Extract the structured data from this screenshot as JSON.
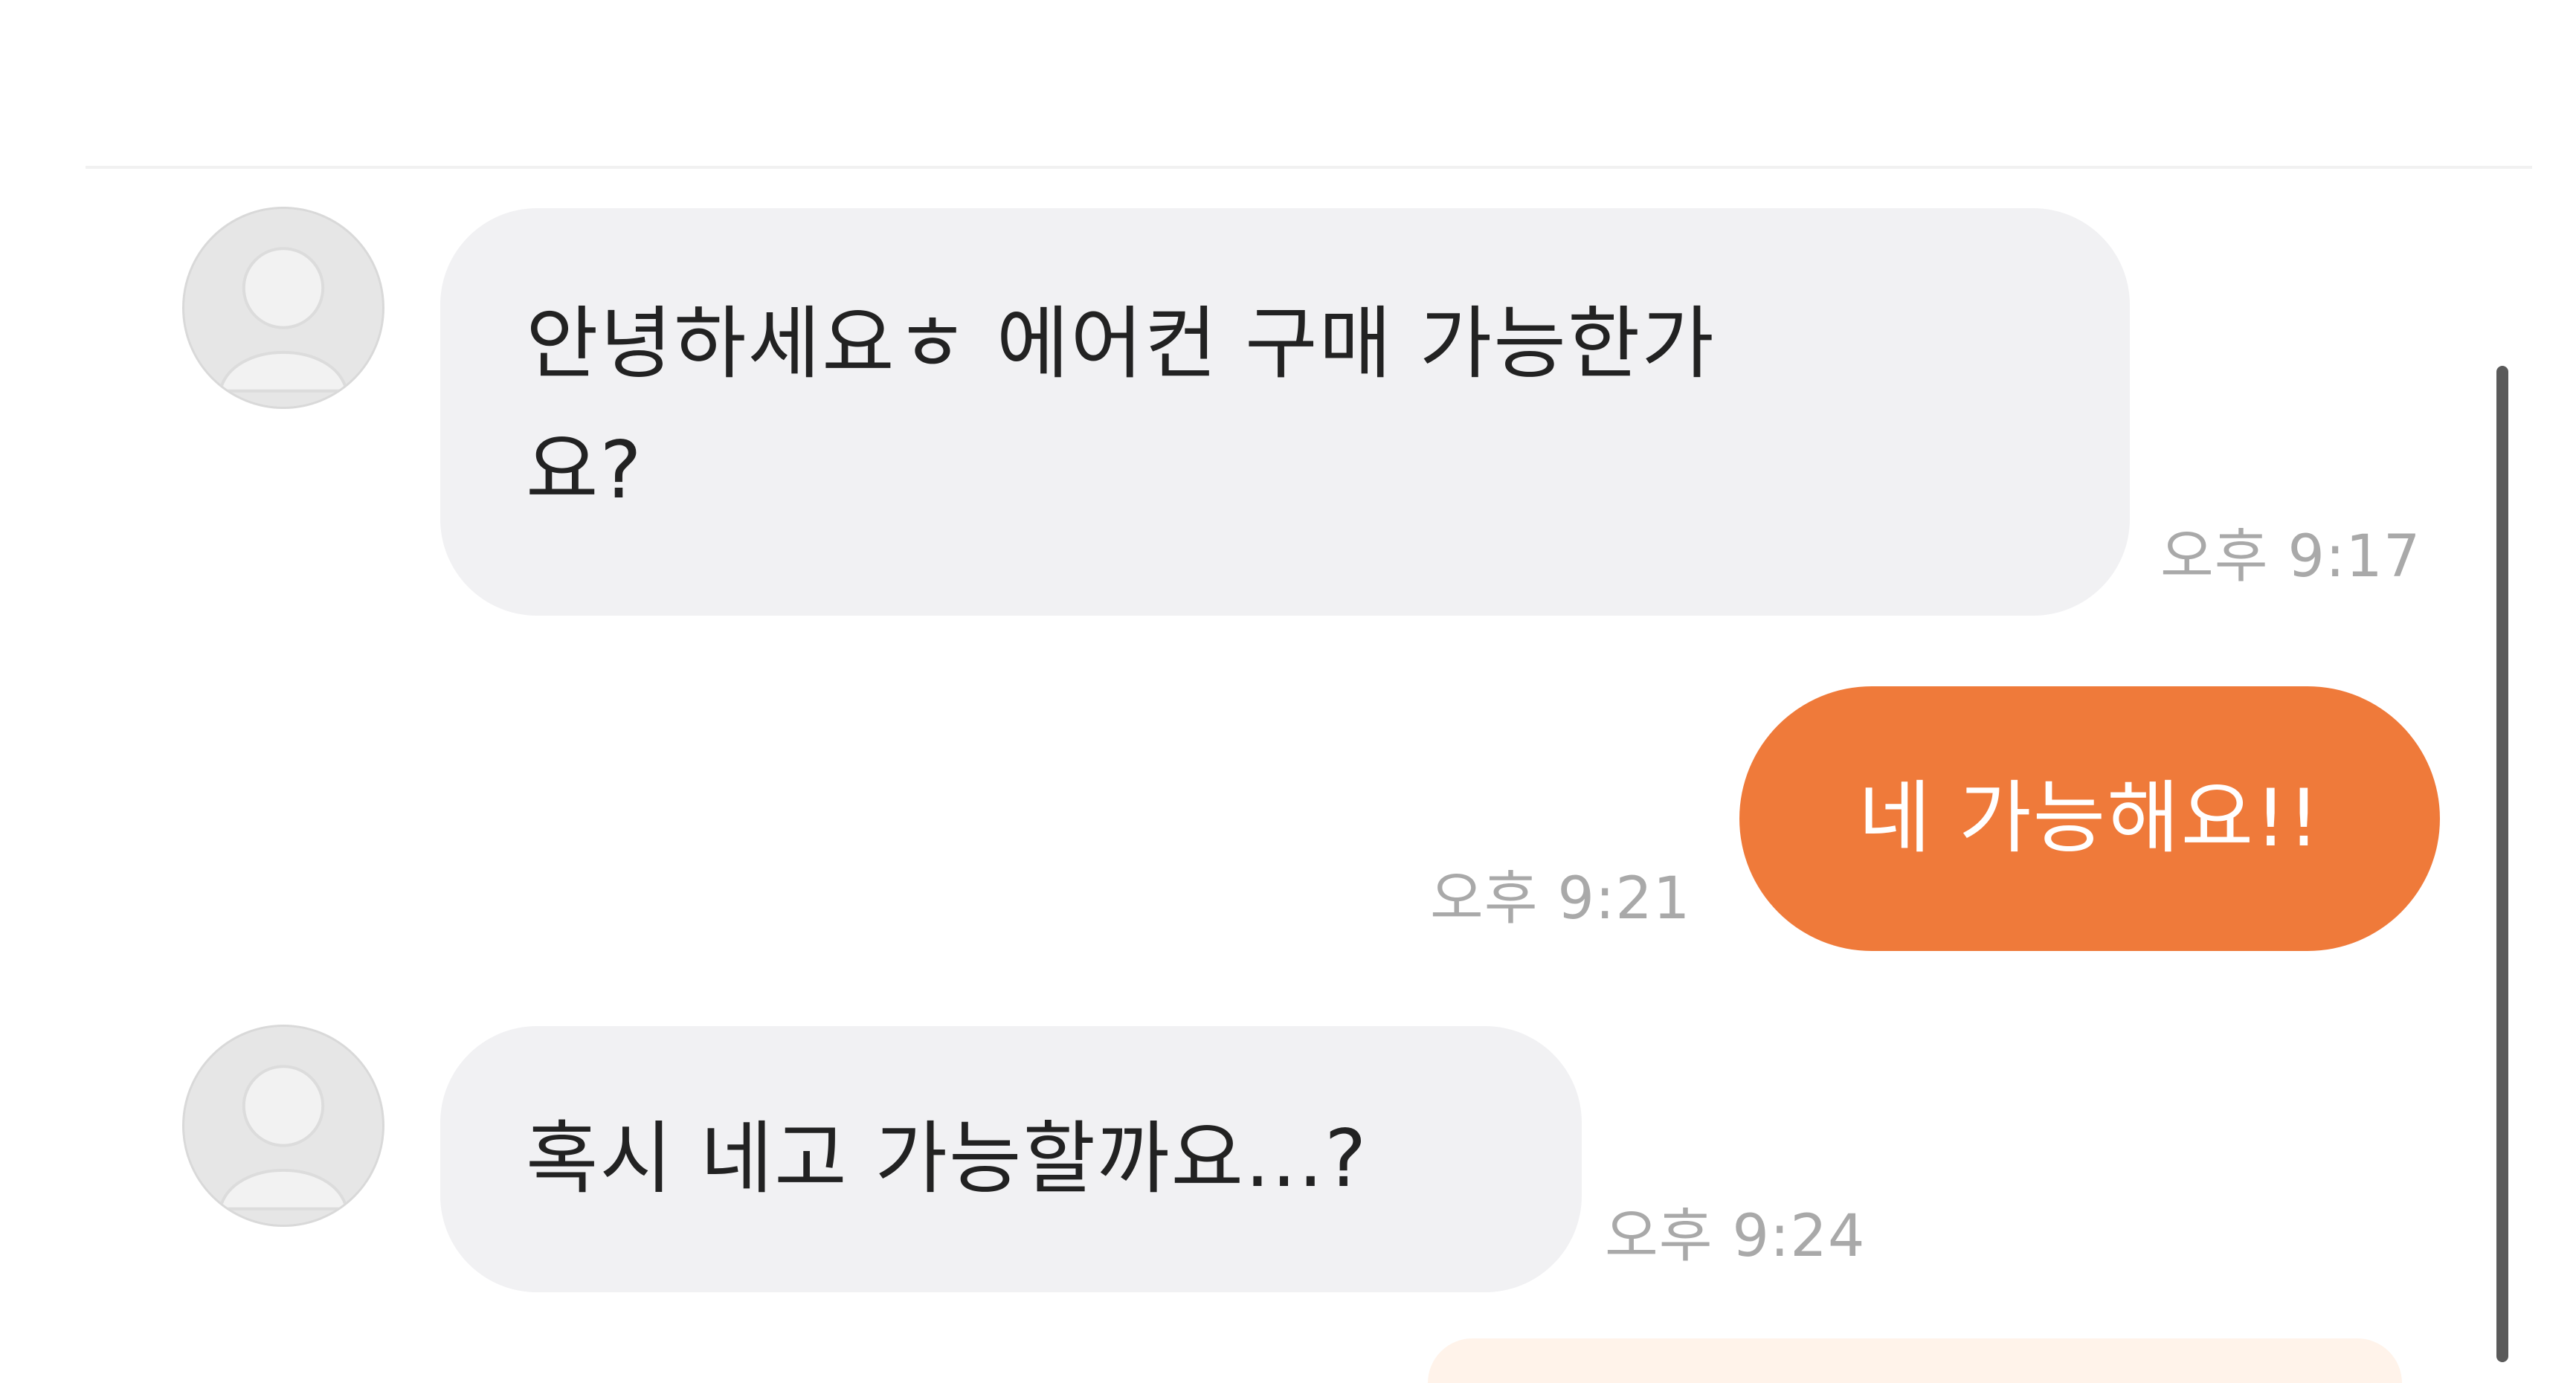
{
  "chat": {
    "messages": [
      {
        "direction": "incoming",
        "lines": [
          "안녕하세요ㅎ 에어컨 구매 가능한가",
          "요?"
        ],
        "time": "오후 9:17"
      },
      {
        "direction": "outgoing",
        "lines": [
          "네 가능해요!!"
        ],
        "time": "오후 9:21"
      },
      {
        "direction": "incoming",
        "lines": [
          "혹시 네고 가능할까요...?"
        ],
        "time": "오후 9:24"
      }
    ]
  },
  "colors": {
    "incoming_bubble": "#f1f1f3",
    "outgoing_bubble": "#ef7a3a",
    "timestamp": "#a9a9a9",
    "avatar": "#e4e4e4"
  },
  "icons": {
    "avatar": "user-placeholder-icon"
  }
}
